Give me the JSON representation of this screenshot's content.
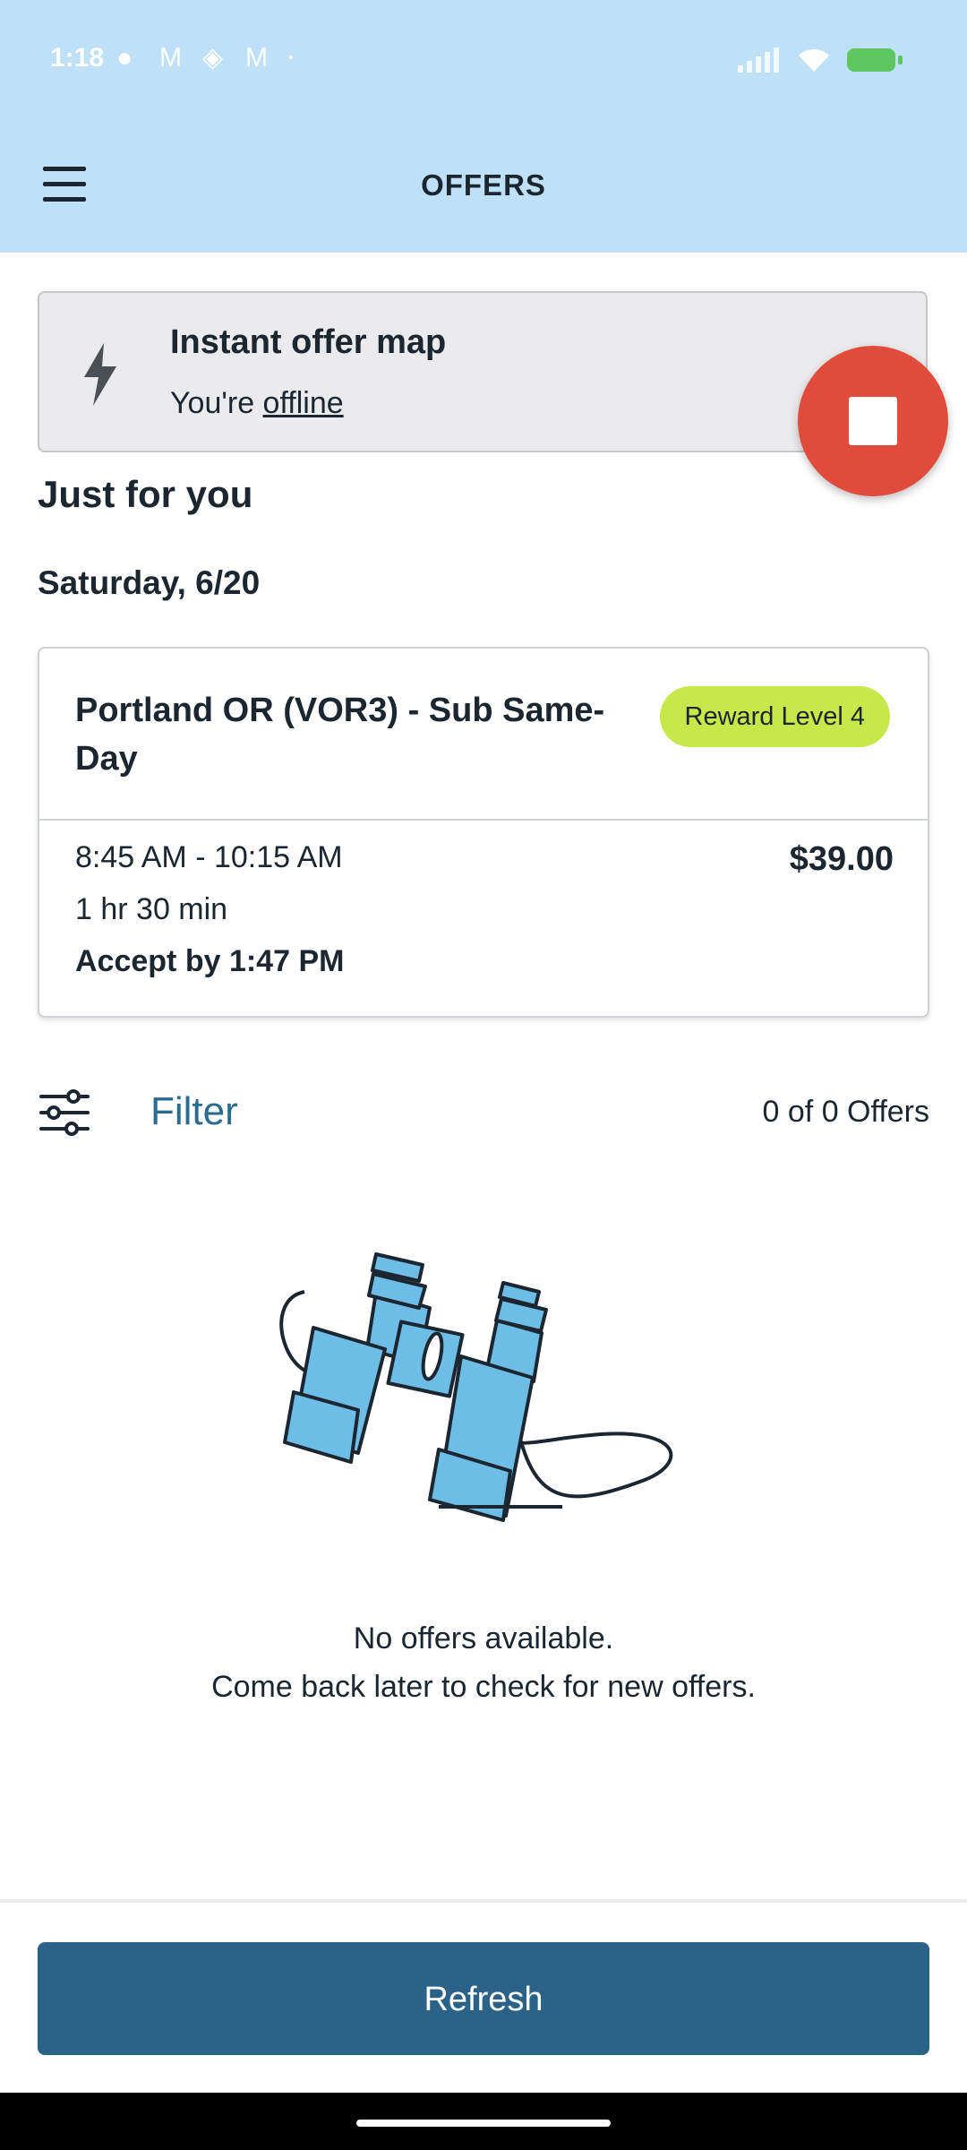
{
  "status_bar": {
    "time": "1:18",
    "notification_icons": [
      "chat-bubble-icon",
      "gmail-icon",
      "diamond-icon",
      "gmail-icon",
      "dot-icon"
    ],
    "signal": "signal-icon",
    "wifi": "wifi-icon",
    "battery": "battery-charging-icon",
    "battery_color": "#5ec85e"
  },
  "header": {
    "title": "OFFERS",
    "background": "#bfe1f8"
  },
  "offer_map": {
    "title": "Instant offer map",
    "status_prefix": "You're ",
    "status_value": "offline"
  },
  "stop_button_color": "#e14b3c",
  "section": {
    "heading": "Just for you",
    "date": "Saturday, 6/20"
  },
  "offer_card": {
    "location": "Portland OR (VOR3) - Sub Same-Day",
    "badge": "Reward Level 4",
    "badge_color": "#c6e84a",
    "time_range": "8:45 AM - 10:15 AM",
    "duration": "1 hr 30 min",
    "accept_by": "Accept by 1:47 PM",
    "price": "$39.00"
  },
  "filter": {
    "label": "Filter",
    "count": "0 of 0 Offers"
  },
  "empty_state": {
    "line1": "No offers available.",
    "line2": "Come back later to check for new offers.",
    "illustration": "binoculars-icon"
  },
  "refresh": {
    "label": "Refresh",
    "color": "#2b6287"
  }
}
